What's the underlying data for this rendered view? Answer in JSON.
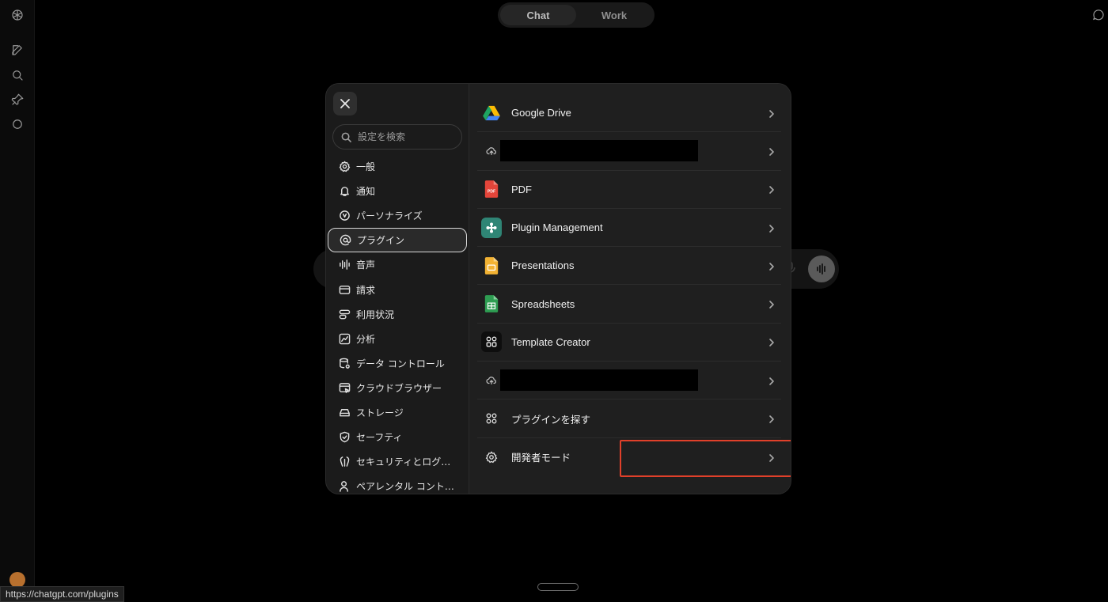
{
  "app": {
    "toggle": {
      "chat": "Chat",
      "work": "Work"
    },
    "status_url": "https://chatgpt.com/plugins"
  },
  "settings": {
    "search_placeholder": "設定を検索",
    "nav": [
      {
        "label": "一般",
        "icon": "gear-icon"
      },
      {
        "label": "通知",
        "icon": "bell-icon"
      },
      {
        "label": "パーソナライズ",
        "icon": "personalize-icon"
      },
      {
        "label": "プラグイン",
        "icon": "at-sign-icon",
        "active": true
      },
      {
        "label": "音声",
        "icon": "waveform-icon"
      },
      {
        "label": "請求",
        "icon": "credit-card-icon"
      },
      {
        "label": "利用状況",
        "icon": "usage-icon"
      },
      {
        "label": "分析",
        "icon": "analytics-icon"
      },
      {
        "label": "データ コントロール",
        "icon": "database-icon"
      },
      {
        "label": "クラウドブラウザー",
        "icon": "cloud-browser-icon"
      },
      {
        "label": "ストレージ",
        "icon": "storage-icon"
      },
      {
        "label": "セーフティ",
        "icon": "shield-icon"
      },
      {
        "label": "セキュリティとログイン",
        "icon": "security-icon"
      },
      {
        "label": "ペアレンタル コントロール",
        "icon": "parent-icon"
      }
    ],
    "plugins": [
      {
        "name": "Google Drive",
        "icon": "google-drive-icon"
      },
      {
        "name": "",
        "icon": "cloud-sync-icon",
        "redacted": true
      },
      {
        "name": "PDF",
        "icon": "pdf-icon"
      },
      {
        "name": "Plugin Management",
        "icon": "plugin-management-icon"
      },
      {
        "name": "Presentations",
        "icon": "presentations-icon"
      },
      {
        "name": "Spreadsheets",
        "icon": "spreadsheets-icon"
      },
      {
        "name": "Template Creator",
        "icon": "template-creator-icon"
      },
      {
        "name": "",
        "icon": "cloud-sync-icon",
        "redacted": true
      },
      {
        "name": "プラグインを探す",
        "icon": "grid-icon"
      },
      {
        "name": "開発者モード",
        "icon": "gear-icon",
        "highlighted": true
      }
    ],
    "highlight_color": "#e0402a"
  }
}
